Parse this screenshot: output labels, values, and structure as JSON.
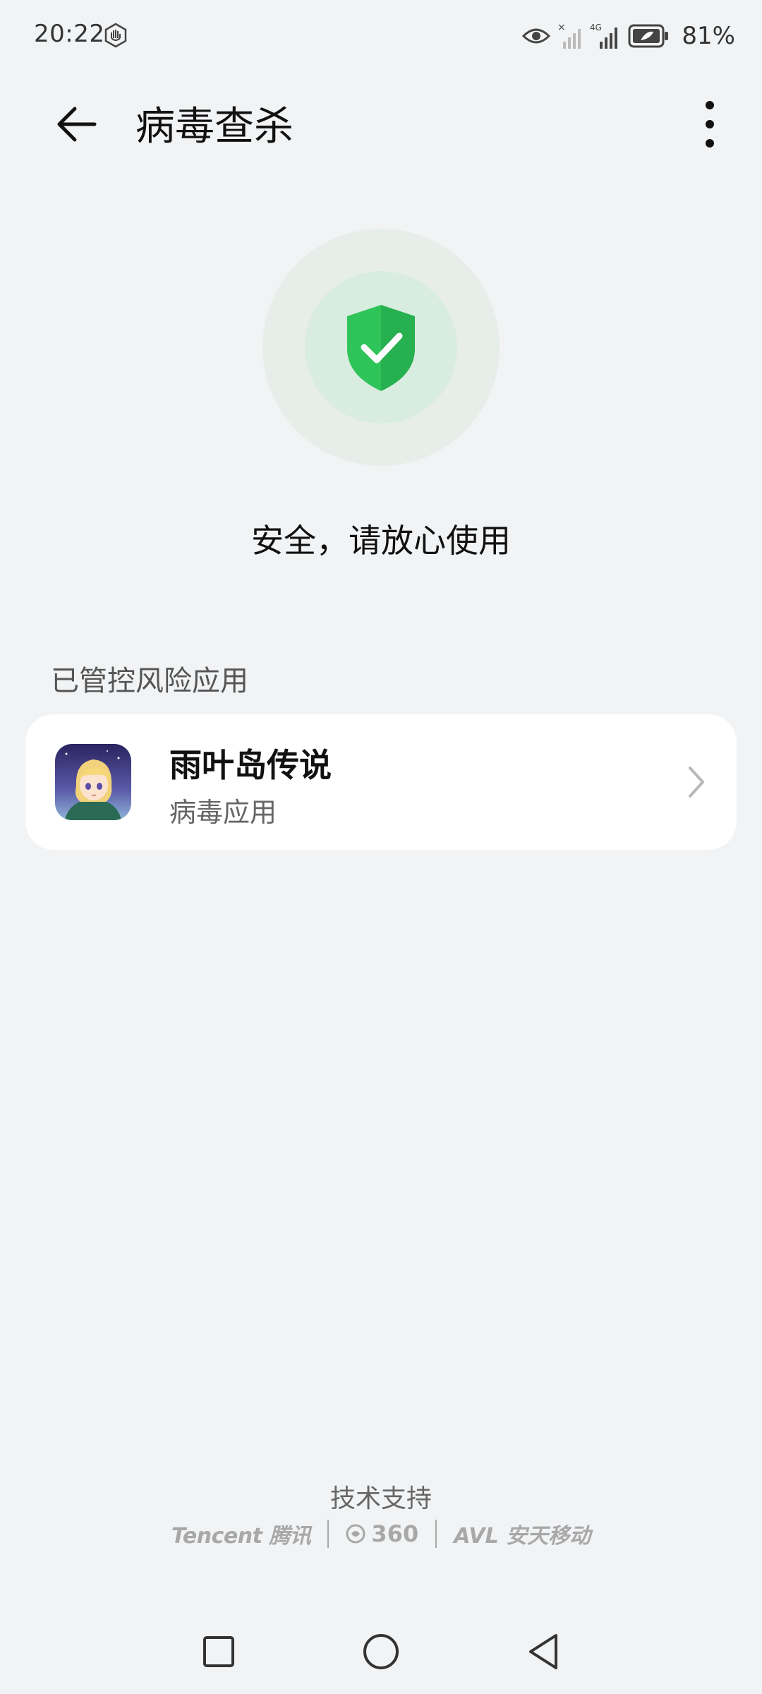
{
  "status_bar": {
    "time": "20:22",
    "battery": "81%",
    "network_label": "4G"
  },
  "header": {
    "title": "病毒查杀"
  },
  "result": {
    "message": "安全，请放心使用",
    "shield_color": "#2fc45a"
  },
  "section": {
    "label": "已管控风险应用"
  },
  "apps": [
    {
      "name": "雨叶岛传说",
      "status": "病毒应用"
    }
  ],
  "footer": {
    "tech_support": "技术支持",
    "partners": {
      "tencent": "Tencent 腾讯",
      "360": "360",
      "antiy": "AVL 安天移动"
    }
  },
  "colors": {
    "background": "#f1f3f5",
    "card": "#ffffff",
    "accent_green": "#2fc45a"
  }
}
